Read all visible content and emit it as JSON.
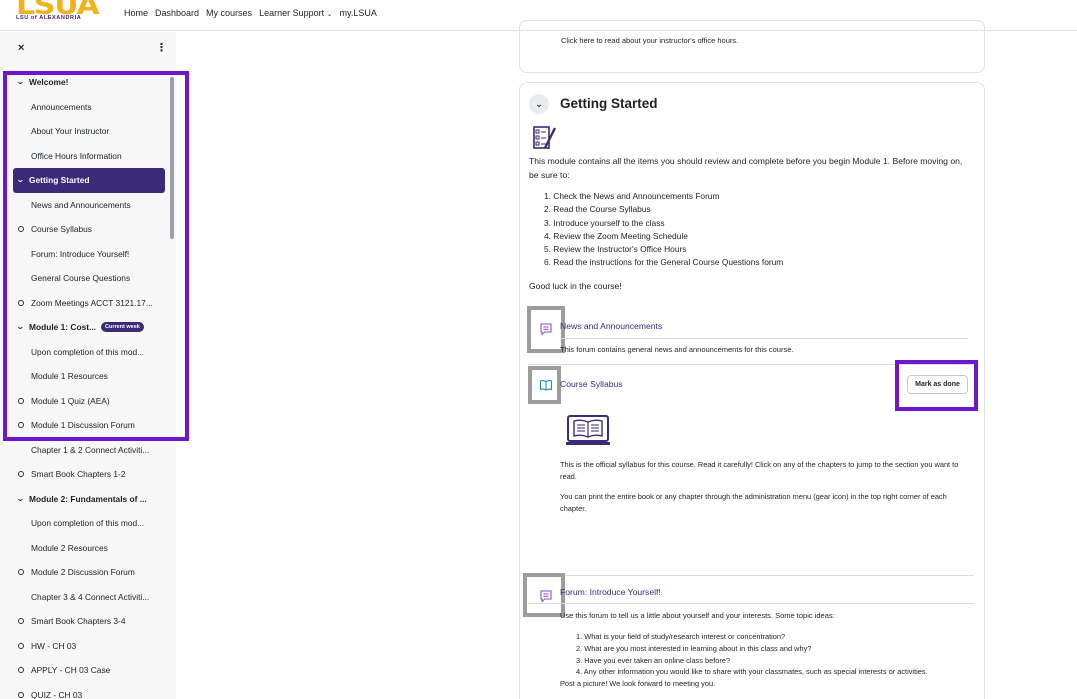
{
  "logo": {
    "main": "LSUA",
    "sub": "LSU of ALEXANDRIA"
  },
  "nav": {
    "home": "Home",
    "dashboard": "Dashboard",
    "my_courses": "My courses",
    "learner_support": "Learner Support",
    "my_lsua": "my.LSUA"
  },
  "sidebar": {
    "close": "×",
    "menu": "⋮",
    "items": [
      {
        "label": "Welcome!",
        "kind": "section"
      },
      {
        "label": "Announcements",
        "kind": "child"
      },
      {
        "label": "About Your Instructor",
        "kind": "child"
      },
      {
        "label": "Office Hours Information",
        "kind": "child"
      },
      {
        "label": "Getting Started",
        "kind": "section-active"
      },
      {
        "label": "News and Announcements",
        "kind": "child"
      },
      {
        "label": "Course Syllabus",
        "kind": "circle"
      },
      {
        "label": "Forum: Introduce Yourself!",
        "kind": "child"
      },
      {
        "label": "General Course Questions",
        "kind": "child"
      },
      {
        "label": "Zoom Meetings ACCT 3121.17...",
        "kind": "circle"
      },
      {
        "label": "Module 1: Cost...",
        "kind": "section",
        "badge": "Current week"
      },
      {
        "label": "Upon completion of this mod...",
        "kind": "child"
      },
      {
        "label": "Module 1 Resources",
        "kind": "child"
      },
      {
        "label": "Module 1 Quiz (AEA)",
        "kind": "circle"
      },
      {
        "label": "Module 1 Discussion Forum",
        "kind": "circle"
      },
      {
        "label": "Chapter 1 & 2 Connect Activiti...",
        "kind": "child"
      },
      {
        "label": "Smart Book Chapters 1-2",
        "kind": "circle"
      },
      {
        "label": "Module 2: Fundamentals of ...",
        "kind": "section"
      },
      {
        "label": "Upon completion of this mod...",
        "kind": "child"
      },
      {
        "label": "Module 2 Resources",
        "kind": "child"
      },
      {
        "label": "Module 2 Discussion Forum",
        "kind": "circle"
      },
      {
        "label": "Chapter 3 & 4 Connect Activiti...",
        "kind": "child"
      },
      {
        "label": "Smart Book Chapters 3-4",
        "kind": "circle"
      },
      {
        "label": "HW - CH 03",
        "kind": "circle"
      },
      {
        "label": "APPLY - CH 03 Case",
        "kind": "circle"
      },
      {
        "label": "QUIZ - CH 03",
        "kind": "circle"
      }
    ]
  },
  "main": {
    "top_card_text": "Click here to read about your instructor's office hours.",
    "section_title": "Getting Started",
    "intro": "This module contains all the items you should review and complete before you begin Module 1. Before moving on, be sure to:",
    "steps": [
      "1. Check the News and Announcements Forum",
      "2. Read the Course Syllabus",
      "3. Introduce yourself to the class",
      "4. Review the Zoom Meeting Schedule",
      "5. Review the Instructor's Office Hours",
      "6. Read the instructions for the General Course Questions forum"
    ],
    "good_luck": "Good luck in the course!",
    "news": {
      "title": "News and Announcements",
      "desc": "This forum contains general news and announcements for this course."
    },
    "syllabus": {
      "title": "Course Syllabus",
      "mark_done": "Mark as done",
      "p1": "This is the official syllabus for this course. Read it carefully! Click on any of the chapters to jump to the section you want to read.",
      "p2": "You can print the entire book or any chapter through the administration menu (gear icon) in the top right corner of each chapter."
    },
    "forum": {
      "title": "Forum: Introduce Yourself!",
      "desc": "Use this forum to tell us a little about yourself and your interests. Some topic ideas:",
      "items": [
        "1. What is your field of study/research interest or concentration?",
        "2. What are you most interested in learning about in this class and why?",
        "3. Have you ever taken an online class before?",
        "4. Any other information you would like to share with your classmates, such as special interests or activities."
      ],
      "post": "Post a picture!  We look forward to meeting you."
    }
  }
}
